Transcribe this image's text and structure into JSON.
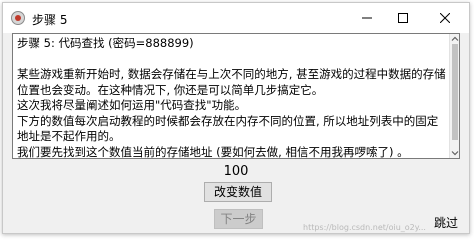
{
  "window": {
    "title": "步骤 5",
    "icon": "cheat-engine-icon",
    "controls": [
      "minimize-icon",
      "maximize-icon",
      "close-icon"
    ]
  },
  "instructions": {
    "text": "步骤 5: 代码查找 (密码=888899)\n\n某些游戏重新开始时, 数据会存储在与上次不同的地方, 甚至游戏的过程中数据的存储位置也会变动。在这种情况下, 你还是可以简单几步搞定它。\n这次我将尽量阐述如何运用\"代码查找\"功能。\n下方的数值每次启动教程的时候都会存放在内存不同的位置, 所以地址列表中的固定地址是不起作用的。\n我们要先找到这个数值当前的存储地址 (要如何去做, 相信不用我再啰嗦了) 。"
  },
  "value_display": "100",
  "buttons": {
    "change_value": "改变数值",
    "next_step": "下一步",
    "skip": "跳过"
  },
  "watermark": "https://blog.csdn.net/oiu_o2y...",
  "colors": {
    "window_bg": "#f0f0f0",
    "button_bg": "#e1e1e1",
    "disabled_text": "#838383"
  }
}
